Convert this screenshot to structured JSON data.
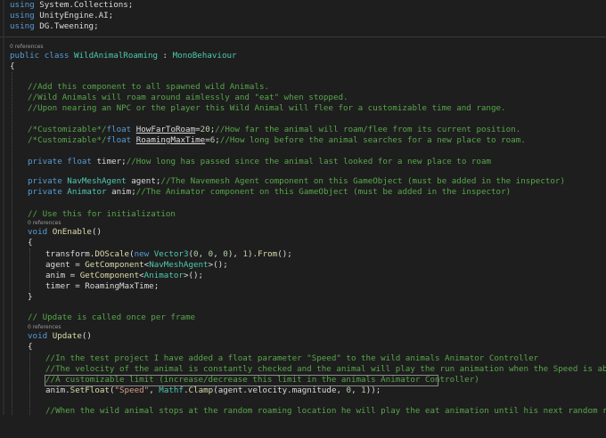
{
  "editor": {
    "usings": [
      {
        "kw": "using",
        "ns": "System.Collections;"
      },
      {
        "kw": "using",
        "ns": "UnityEngine.AI;"
      },
      {
        "kw": "using",
        "ns": "DG.Tweening;"
      }
    ],
    "refs_label": "0 references",
    "class_line": {
      "kw1": "public",
      "kw2": "class",
      "name": "WildAnimalRoaming",
      "sep": " : ",
      "base": "MonoBehaviour"
    },
    "open_brace": "{",
    "close_brace": "}",
    "header_comments": [
      "//Add this component to all spawned wild Animals.",
      "//Wild Animals will roam around aimlessly and \"eat\" when stopped.",
      "//Upon nearing an NPC or the player this Wild Animal will flee for a customizable time and range."
    ],
    "field1": {
      "cm": "/*Customizable*/",
      "kw": "float",
      "name": "HowFarToRoam",
      "assign": "=",
      "value": "20",
      "semi": ";",
      "comment": "//How far the animal will roam/flee from its current position."
    },
    "field2": {
      "cm": "/*Customizable*/",
      "kw": "float",
      "name": "RoamingMaxTime",
      "assign": "=",
      "value": "6",
      "semi": ";",
      "comment": "//How long before the animal searches for a new place to roam."
    },
    "field3": {
      "kw1": "private",
      "kw2": "float",
      "name": "timer;",
      "comment": "//How long has passed since the animal last looked for a new place to roam"
    },
    "field4": {
      "kw": "private",
      "type": "NavMeshAgent",
      "name": " agent;",
      "comment": "//The Navemesh Agent component on this GameObject (must be added in the inspector)"
    },
    "field5": {
      "kw": "private",
      "type": "Animator",
      "name": " anim;",
      "comment": "//The Animator component on this GameObject (must be added in the inspector)"
    },
    "init_comment": "// Use this for initialization",
    "onenable": {
      "kw": "void",
      "name": "OnEnable",
      "parens": "()"
    },
    "onenable_body": {
      "l1": {
        "a": "transform.",
        "fn": "DOScale",
        "b": "(",
        "kw": "new",
        "ty": " Vector3",
        "c": "(",
        "n1": "0",
        "d": ", ",
        "n2": "0",
        "e": ", ",
        "n3": "0",
        "f": "), ",
        "n4": "1",
        "g": ").",
        "fn2": "From",
        "h": "();"
      },
      "l2": {
        "a": "agent = ",
        "fn": "GetComponent",
        "b": "<",
        "ty": "NavMeshAgent",
        "c": ">();"
      },
      "l3": {
        "a": "anim = ",
        "fn": "GetComponent",
        "b": "<",
        "ty": "Animator",
        "c": ">();"
      },
      "l4": {
        "a": "timer = RoamingMaxTime;"
      }
    },
    "update_comment": "// Update is called once per frame",
    "update": {
      "kw": "void",
      "name": "Update",
      "parens": "()"
    },
    "update_comments": [
      "//In the test project I have added a float parameter \"Speed\" to the wild animals Animator Controller",
      "//The velocity of the animal is constantly checked and the animal will play the run animation when the Speed is above",
      "//A customizable limit (increase/decrease this limit in the animals Animator Controller)"
    ],
    "setfloat": {
      "a": "anim.",
      "fn": "SetFloat",
      "b": "(",
      "st": "\"Speed\"",
      "c": ", ",
      "ty": "Mathf",
      "d": ".",
      "fn2": "Clamp",
      "e": "(agent.velocity.magnitude, ",
      "n1": "0",
      "f": ", ",
      "n2": "1",
      "g": "));"
    },
    "last_comment": "//When the wild animal stops at the random roaming location he will play the eat animation until his next random roam."
  }
}
